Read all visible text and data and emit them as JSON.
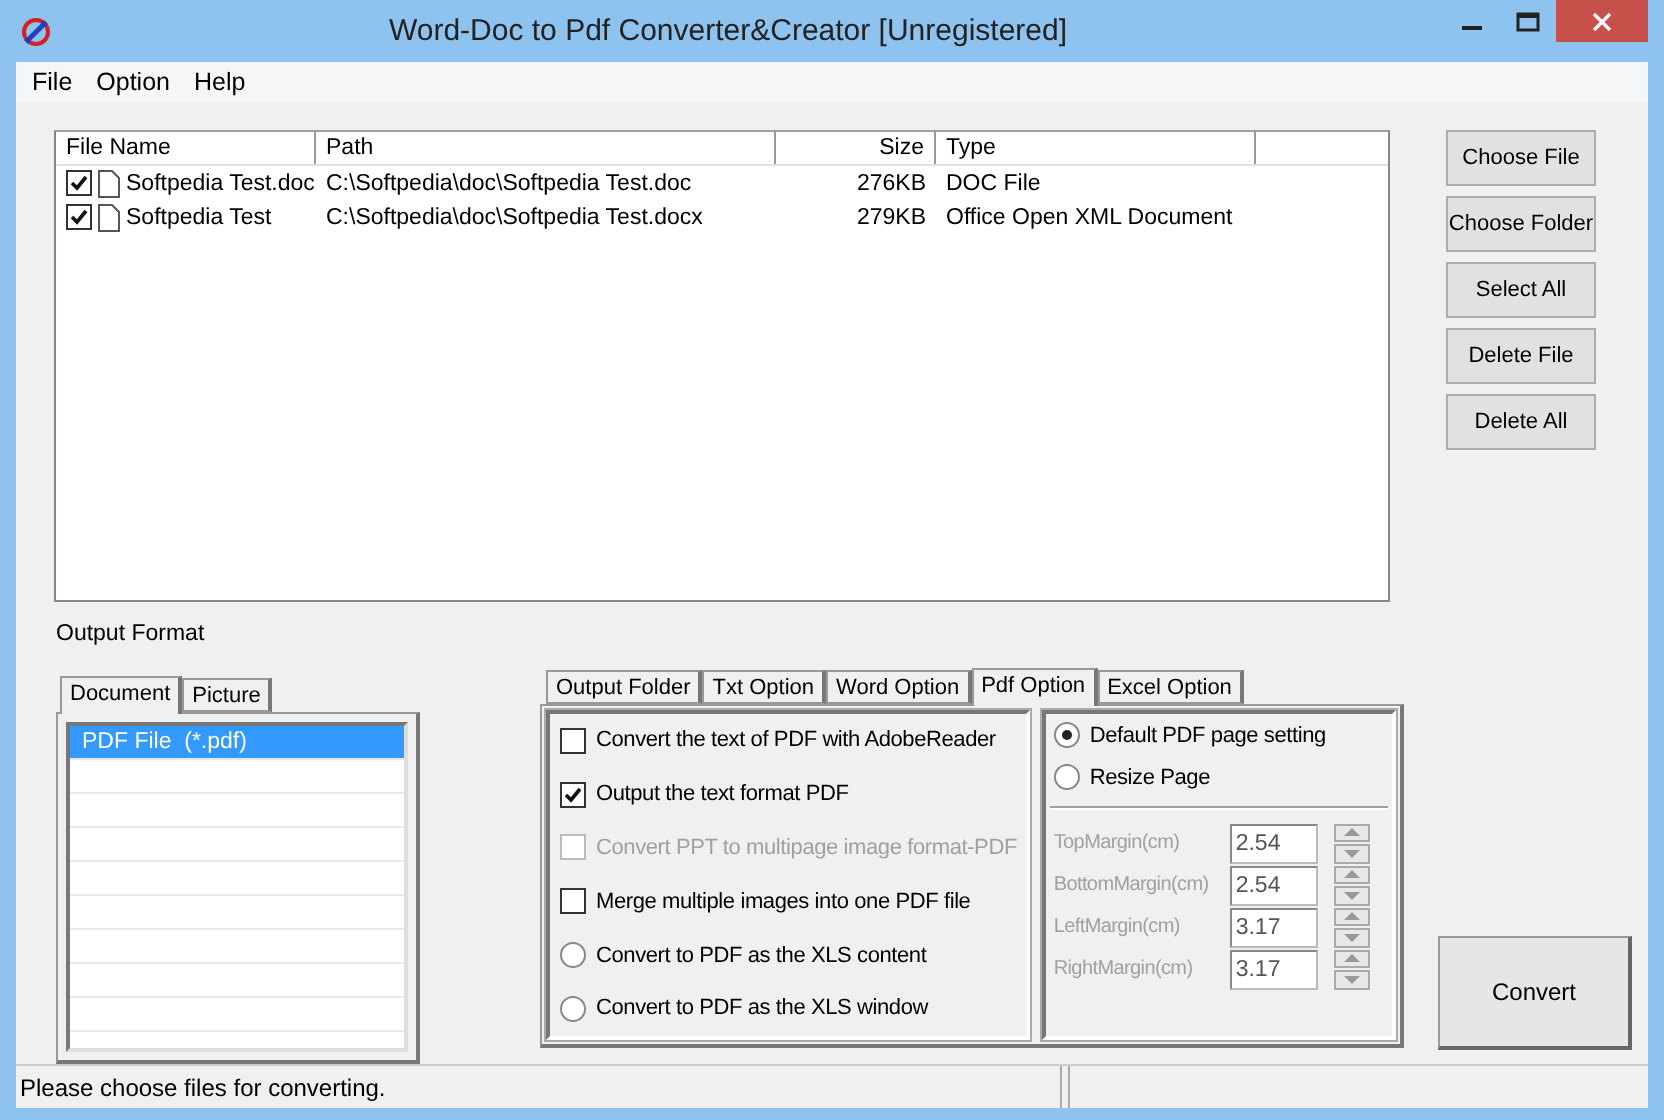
{
  "window": {
    "title": "Word-Doc to Pdf Converter&Creator [Unregistered]"
  },
  "menu": [
    "File",
    "Option",
    "Help"
  ],
  "file_table": {
    "columns": [
      "File Name",
      "Path",
      "Size",
      "Type"
    ],
    "rows": [
      {
        "checked": true,
        "name": "Softpedia Test.doc",
        "path": "C:\\Softpedia\\doc\\Softpedia Test.doc",
        "size": "276KB",
        "type": "DOC File"
      },
      {
        "checked": true,
        "name": "Softpedia Test",
        "path": "C:\\Softpedia\\doc\\Softpedia Test.docx",
        "size": "279KB",
        "type": "Office Open XML Document"
      }
    ]
  },
  "buttons": [
    "Choose File",
    "Choose Folder",
    "Select All",
    "Delete File",
    "Delete All"
  ],
  "output_format": {
    "label": "Output Format",
    "tabs": [
      {
        "label": "Document",
        "selected": true
      },
      {
        "label": "Picture",
        "selected": false
      }
    ],
    "items": [
      {
        "label": "PDF File  (*.pdf)",
        "selected": true
      }
    ]
  },
  "options": {
    "tabs": [
      {
        "label": "Output Folder",
        "selected": false
      },
      {
        "label": "Txt Option",
        "selected": false
      },
      {
        "label": "Word Option",
        "selected": false
      },
      {
        "label": "Pdf Option",
        "selected": true
      },
      {
        "label": "Excel Option",
        "selected": false
      }
    ],
    "choices": [
      {
        "kind": "checkbox",
        "label": "Convert the text of PDF with AdobeReader",
        "checked": false,
        "disabled": false
      },
      {
        "kind": "checkbox",
        "label": "Output the text format PDF",
        "checked": true,
        "disabled": false
      },
      {
        "kind": "checkbox",
        "label": "Convert PPT to multipage image format-PDF",
        "checked": false,
        "disabled": true
      },
      {
        "kind": "checkbox",
        "label": "Merge multiple images into one PDF file",
        "checked": false,
        "disabled": false
      },
      {
        "kind": "radio",
        "label": "Convert to PDF as the XLS content",
        "selected": false
      },
      {
        "kind": "radio",
        "label": "Convert to PDF as the XLS window",
        "selected": false
      }
    ],
    "page": {
      "choices": [
        {
          "label": "Default PDF page setting",
          "selected": true
        },
        {
          "label": "Resize Page",
          "selected": false
        }
      ],
      "margins": [
        {
          "label": "TopMargin(cm)",
          "value": "2.54",
          "disabled": true
        },
        {
          "label": "BottomMargin(cm)",
          "value": "2.54",
          "disabled": true
        },
        {
          "label": "LeftMargin(cm)",
          "value": "3.17",
          "disabled": true
        },
        {
          "label": "RightMargin(cm)",
          "value": "3.17",
          "disabled": true
        }
      ]
    }
  },
  "convert_button": "Convert",
  "status_bar": {
    "message": "Please choose files for converting."
  }
}
